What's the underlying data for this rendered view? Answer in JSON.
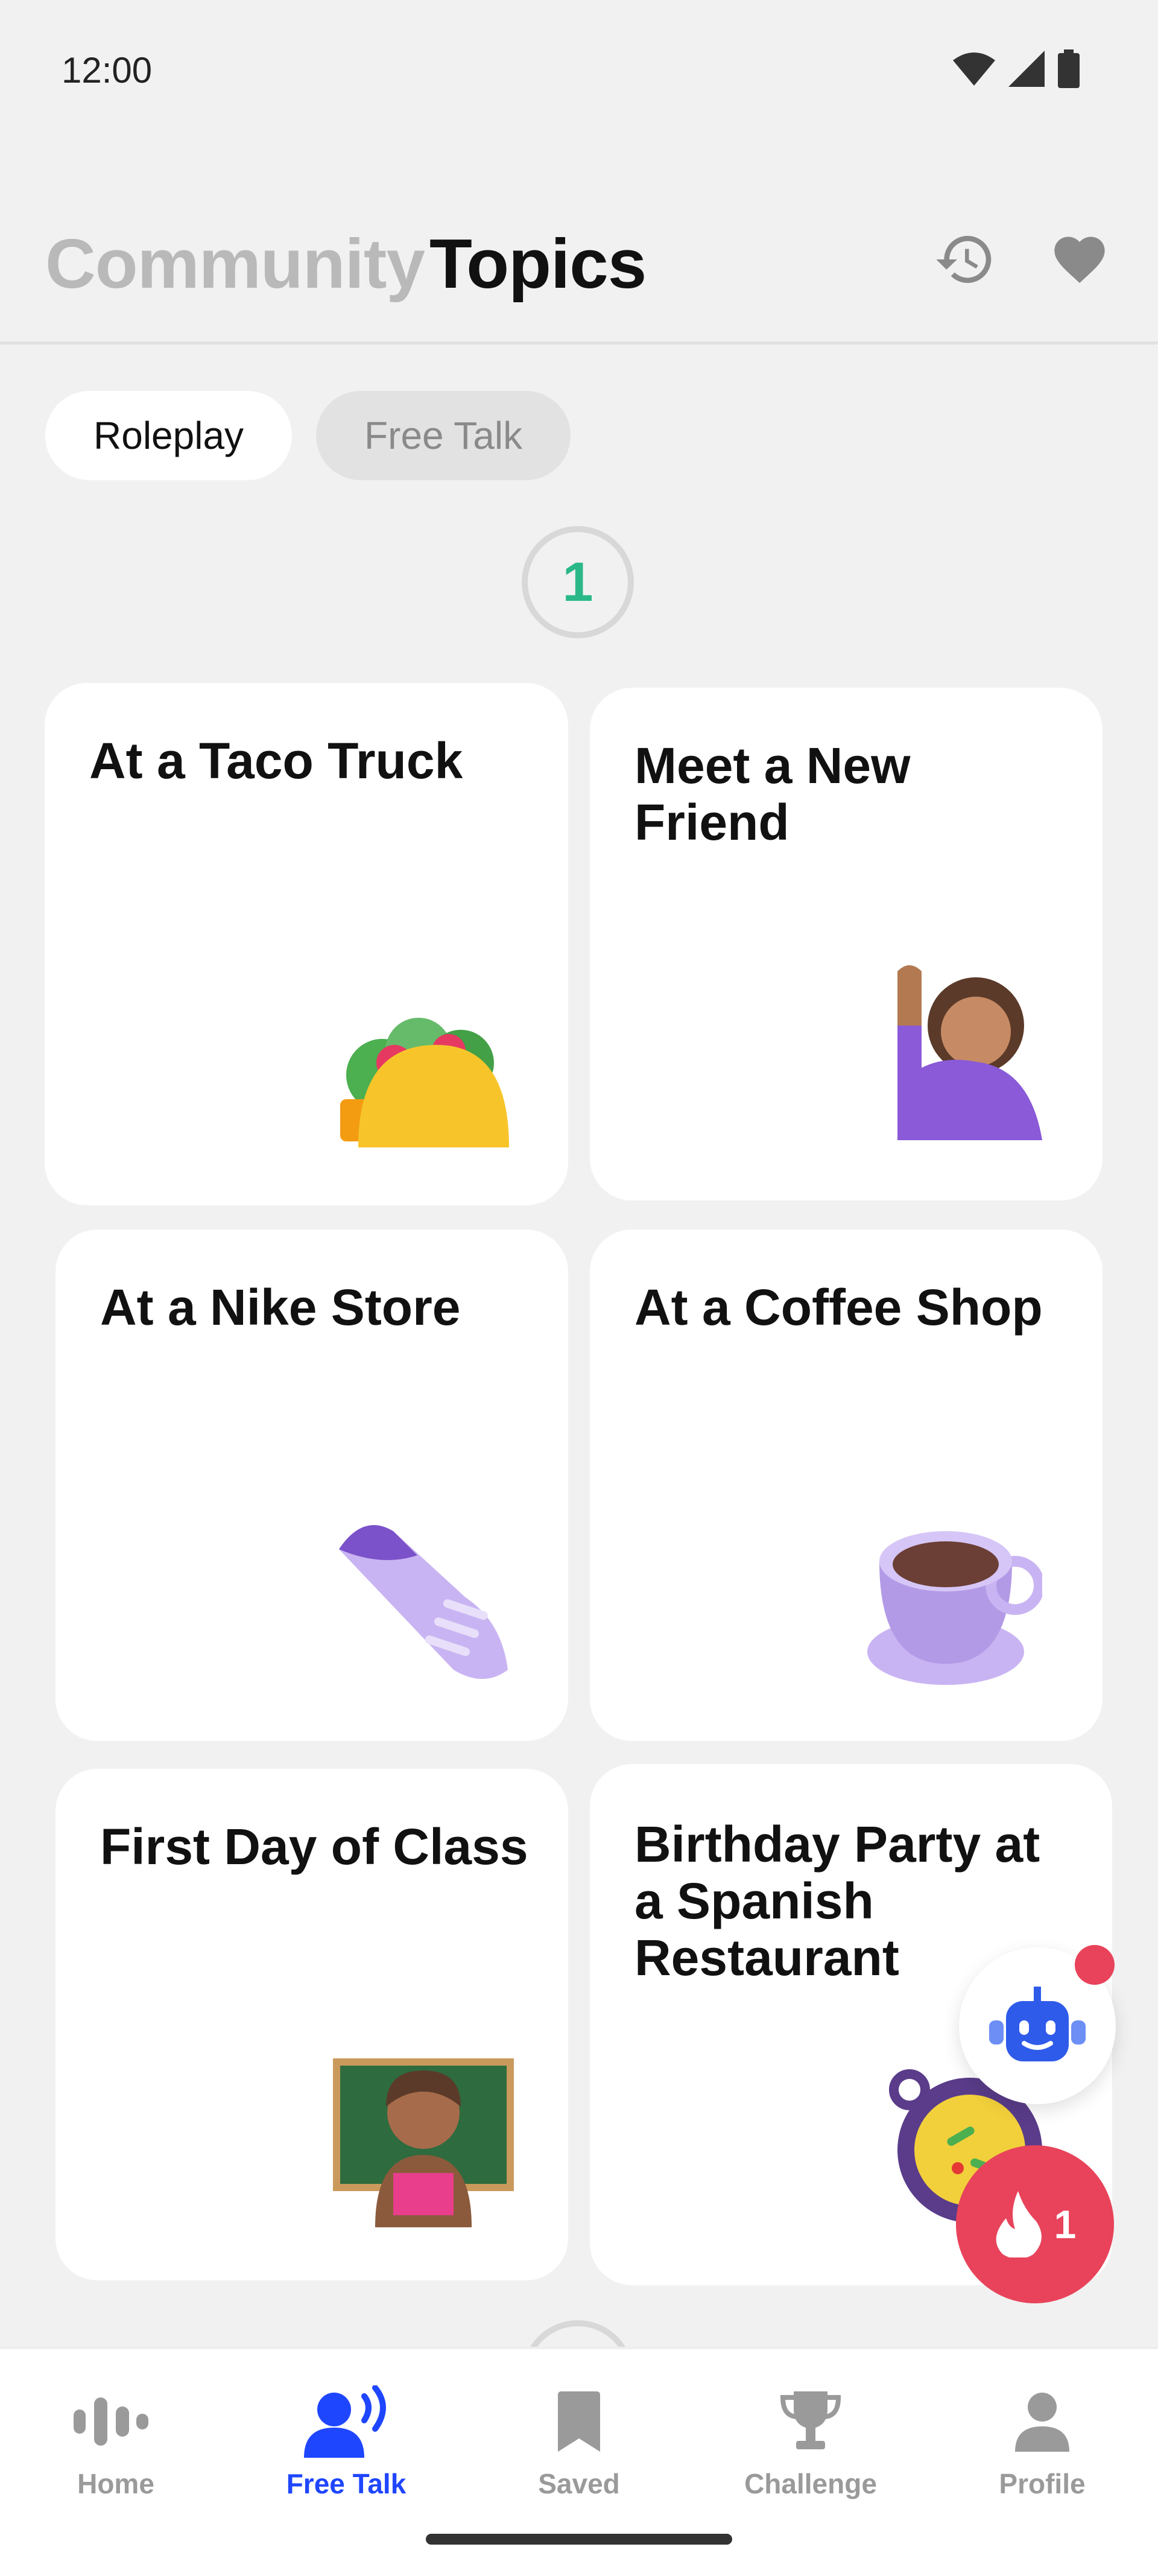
{
  "status_bar": {
    "time": "12:00"
  },
  "header": {
    "tabs": [
      "Community",
      "Topics"
    ],
    "active_tab": "Topics"
  },
  "chips": {
    "roleplay": "Roleplay",
    "free_talk": "Free Talk",
    "active": "Roleplay"
  },
  "level": {
    "number": "1"
  },
  "cards": [
    {
      "title": "At a Taco Truck",
      "icon": "taco-icon"
    },
    {
      "title": "Meet a New Friend",
      "icon": "waving-woman-icon"
    },
    {
      "title": "At a Nike Store",
      "icon": "sneaker-icon"
    },
    {
      "title": "At a Coffee Shop",
      "icon": "coffee-cup-icon"
    },
    {
      "title": "First Day of Class",
      "icon": "teacher-icon"
    },
    {
      "title": "Birthday Party at a Spanish Restaurant",
      "icon": "paella-icon"
    }
  ],
  "fab": {
    "streak_count": "1"
  },
  "nav": {
    "items": [
      "Home",
      "Free Talk",
      "Saved",
      "Challenge",
      "Profile"
    ],
    "active": "Free Talk"
  },
  "colors": {
    "accent": "#1f46ff",
    "level": "#2bb889",
    "streak": "#e8435a"
  }
}
